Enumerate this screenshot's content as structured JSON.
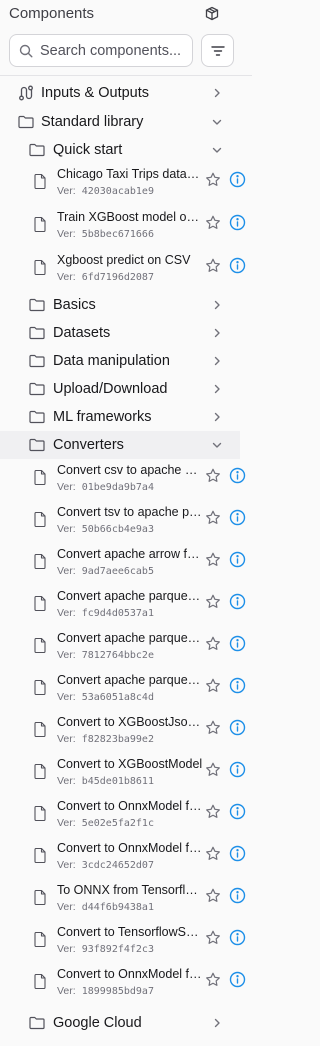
{
  "header": {
    "title": "Components",
    "package_icon": "package-plus-icon"
  },
  "search": {
    "placeholder": "Search components..."
  },
  "tree": {
    "inputs_outputs": "Inputs & Outputs",
    "standard_library": "Standard library",
    "quick_start": "Quick start",
    "basics": "Basics",
    "datasets": "Datasets",
    "data_manipulation": "Data manipulation",
    "upload_download": "Upload/Download",
    "ml_frameworks": "ML frameworks",
    "converters": "Converters",
    "google_cloud": "Google Cloud"
  },
  "ver_prefix": "Ver:",
  "quick_start_items": [
    {
      "name": "Chicago Taxi Trips dataset",
      "ver": "42030acab1e9"
    },
    {
      "name": "Train XGBoost model on CSV",
      "ver": "5b8bec671666"
    },
    {
      "name": "Xgboost predict on CSV",
      "ver": "6fd7196d2087"
    }
  ],
  "converter_items": [
    {
      "name": "Convert csv to apache parquet",
      "ver": "01be9da9b7a4"
    },
    {
      "name": "Convert tsv to apache parquet",
      "ver": "50b66cb4e9a3"
    },
    {
      "name": "Convert apache arrow feather to apache parquet",
      "ver": "9ad7aee6cab5"
    },
    {
      "name": "Convert apache parquet to apache arrow feather",
      "ver": "fc9d4d0537a1"
    },
    {
      "name": "Convert apache parquet to csv",
      "ver": "7812764bbc2e"
    },
    {
      "name": "Convert apache parquet to tsv",
      "ver": "53a6051a8c4d"
    },
    {
      "name": "Convert to XGBoostJsonModel",
      "ver": "f82823ba99e2"
    },
    {
      "name": "Convert to XGBoostModel",
      "ver": "b45de01b8611"
    },
    {
      "name": "Convert to OnnxModel from PyTorch",
      "ver": "5e02e5fa2f1c"
    },
    {
      "name": "Convert to OnnxModel from Keras",
      "ver": "3cdc24652d07"
    },
    {
      "name": "To ONNX from Tensorflow SavedModel",
      "ver": "d44f6b9438a1"
    },
    {
      "name": "Convert to TensorflowSavedModel",
      "ver": "93f892f4f2c3"
    },
    {
      "name": "Convert to OnnxModel from Tensorflow",
      "ver": "1899985bd9a7"
    }
  ]
}
